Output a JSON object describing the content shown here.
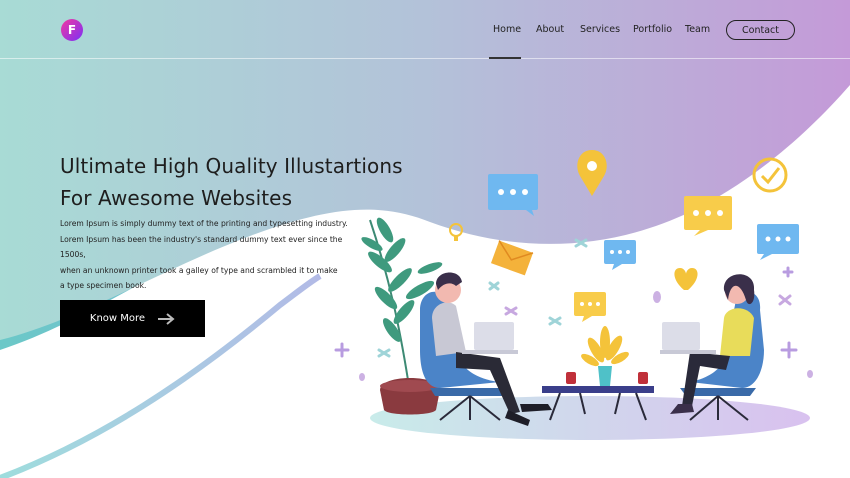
{
  "brand": {
    "logo_letter": "F",
    "logo_icon": "brand-f-logo"
  },
  "nav": {
    "items": [
      {
        "label": "Home",
        "active": true
      },
      {
        "label": "About",
        "active": false
      },
      {
        "label": "Services",
        "active": false
      },
      {
        "label": "Portfolio",
        "active": false
      },
      {
        "label": "Team",
        "active": false
      }
    ],
    "contact_label": "Contact"
  },
  "hero": {
    "title_line1": "Ultimate High Quality Illustartions",
    "title_line2": "For Awesome Websites",
    "description": [
      "Lorem Ipsum is simply dummy text of the printing and typesetting industry.",
      "Lorem Ipsum has been the industry's standard dummy text ever since the 1500s,",
      "when an unknown printer took a galley of type and scrambled it to make",
      "a type specimen book."
    ],
    "cta_label": "Know More",
    "cta_icon": "arrow-right-icon"
  },
  "colors": {
    "gradient_left": "#a9dad6",
    "gradient_right": "#c39ad8",
    "cta_bg": "#000000",
    "bubble_blue": "#6fb8f0",
    "bubble_yellow": "#f8cc4a"
  }
}
